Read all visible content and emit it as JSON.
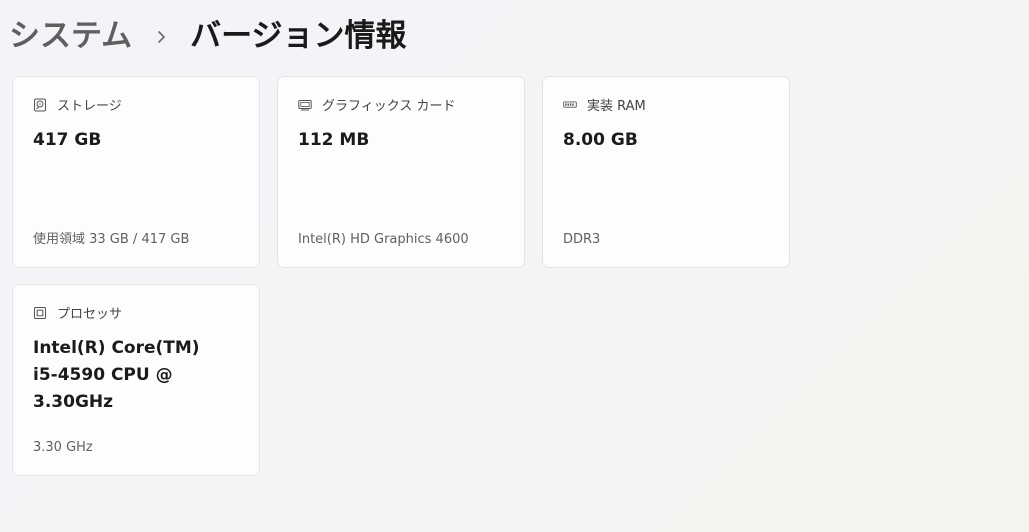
{
  "breadcrumb": {
    "parent": "システム",
    "separator_icon": "chevron-right-icon",
    "current": "バージョン情報"
  },
  "cards": {
    "storage": {
      "icon": "storage-drive-icon",
      "label": "ストレージ",
      "value": "417 GB",
      "detail": "使用領域 33 GB / 417 GB"
    },
    "graphics": {
      "icon": "display-icon",
      "label": "グラフィックス カード",
      "value": "112 MB",
      "detail": "Intel(R) HD Graphics 4600"
    },
    "memory": {
      "icon": "memory-ram-icon",
      "label": "実装 RAM",
      "value": "8.00 GB",
      "detail": "DDR3"
    },
    "processor": {
      "icon": "processor-chip-icon",
      "label": "プロセッサ",
      "value": "Intel(R) Core(TM) i5-4590 CPU @ 3.30GHz",
      "detail": "3.30 GHz"
    }
  }
}
